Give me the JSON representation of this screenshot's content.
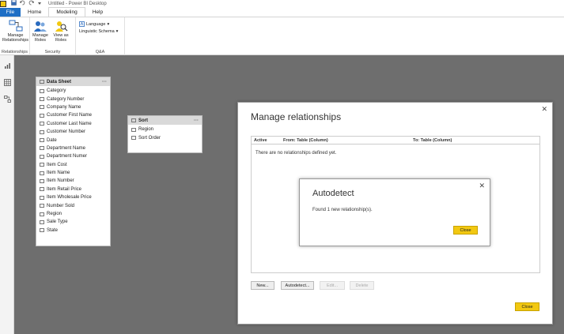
{
  "window": {
    "title": "Untitled - Power BI Desktop"
  },
  "quick_access": {
    "icons": [
      "save-icon",
      "undo-icon",
      "redo-icon",
      "customize-icon"
    ]
  },
  "tabs": [
    {
      "label": "File"
    },
    {
      "label": "Home"
    },
    {
      "label": "Modeling"
    },
    {
      "label": "Help"
    }
  ],
  "ribbon": {
    "relationships": {
      "group": "Relationships",
      "manage": "Manage\nRelationships"
    },
    "security": {
      "group": "Security",
      "manage_roles": "Manage\nRoles",
      "view_as": "View as\nRoles"
    },
    "qa": {
      "group": "Q&A",
      "language": "Language",
      "schema": "Linguistic Schema"
    }
  },
  "tables": {
    "data_sheet": {
      "name": "Data Sheet",
      "fields": [
        "Category",
        "Category Number",
        "Company Name",
        "Customer First Name",
        "Customer Last Name",
        "Customer Number",
        "Date",
        "Department Name",
        "Department Numer",
        "Item Cost",
        "Item Name",
        "Item Number",
        "Item Retail Price",
        "Item Wholesale Price",
        "Number Sold",
        "Region",
        "Sale Type",
        "State"
      ]
    },
    "sort": {
      "name": "Sort",
      "fields": [
        "Region",
        "Sort Order"
      ]
    }
  },
  "manage_dialog": {
    "title": "Manage relationships",
    "columns": {
      "active": "Active",
      "from": "From: Table (Column)",
      "to": "To: Table (Column)"
    },
    "empty": "There are no relationships defined yet.",
    "buttons": {
      "new": "New...",
      "autodetect": "Autodetect...",
      "edit": "Edit...",
      "delete": "Delete",
      "close": "Close"
    }
  },
  "autodetect_dialog": {
    "title": "Autodetect",
    "message": "Found 1 new relationship(s).",
    "close": "Close"
  },
  "close_glyph": "✕",
  "menu_dots": "···",
  "colors": {
    "accent": "#f2c811",
    "file_tab": "#1f6fc5",
    "canvas": "#6e6e6e"
  }
}
